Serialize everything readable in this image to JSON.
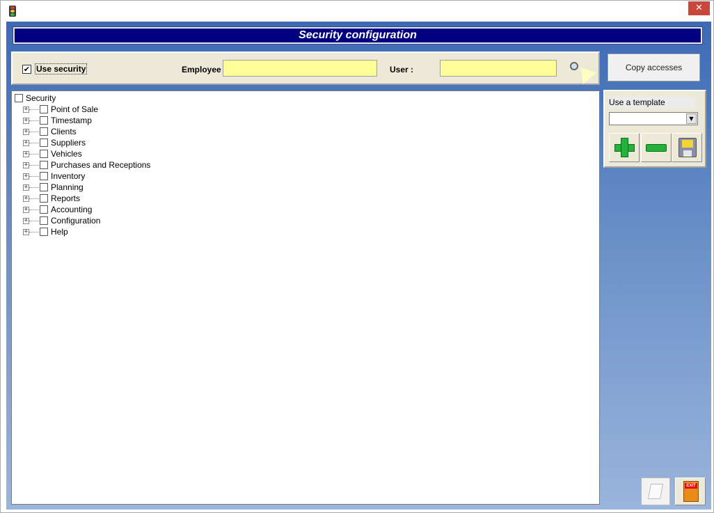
{
  "window": {
    "close_glyph": "✕"
  },
  "header": {
    "title": "Security configuration"
  },
  "top_panel": {
    "use_security_label": "Use security",
    "use_security_checked": true,
    "check_glyph": "✔",
    "employee_label": "Employee",
    "employee_value": "",
    "user_label": "User :",
    "user_value": ""
  },
  "copy_button_label": "Copy accesses",
  "tree": {
    "root_label": "Security",
    "expander_glyph": "+",
    "items": [
      {
        "label": "Point of Sale"
      },
      {
        "label": "Timestamp"
      },
      {
        "label": "Clients"
      },
      {
        "label": "Suppliers"
      },
      {
        "label": "Vehicles"
      },
      {
        "label": "Purchases and Receptions"
      },
      {
        "label": "Inventory"
      },
      {
        "label": "Planning"
      },
      {
        "label": "Reports"
      },
      {
        "label": "Accounting"
      },
      {
        "label": "Configuration"
      },
      {
        "label": "Help"
      }
    ]
  },
  "template_panel": {
    "label": "Use a template",
    "selected_value": "",
    "dropdown_glyph": "▼"
  },
  "exit_sign": "EXIT",
  "icons": {
    "app": "traffic-light-icon",
    "search": "magnifier-pointer-icon",
    "add": "green-plus-icon",
    "remove": "green-minus-icon",
    "save": "floppy-disk-icon",
    "print": "printer-icon",
    "exit": "exit-door-icon"
  },
  "colors": {
    "banner_bg": "#000080",
    "input_bg": "#ffff99",
    "client_gradient_top": "#3d6ab5",
    "client_gradient_bottom": "#9ab5dc",
    "close_button": "#c9473a",
    "accent_green": "#22b33a"
  }
}
